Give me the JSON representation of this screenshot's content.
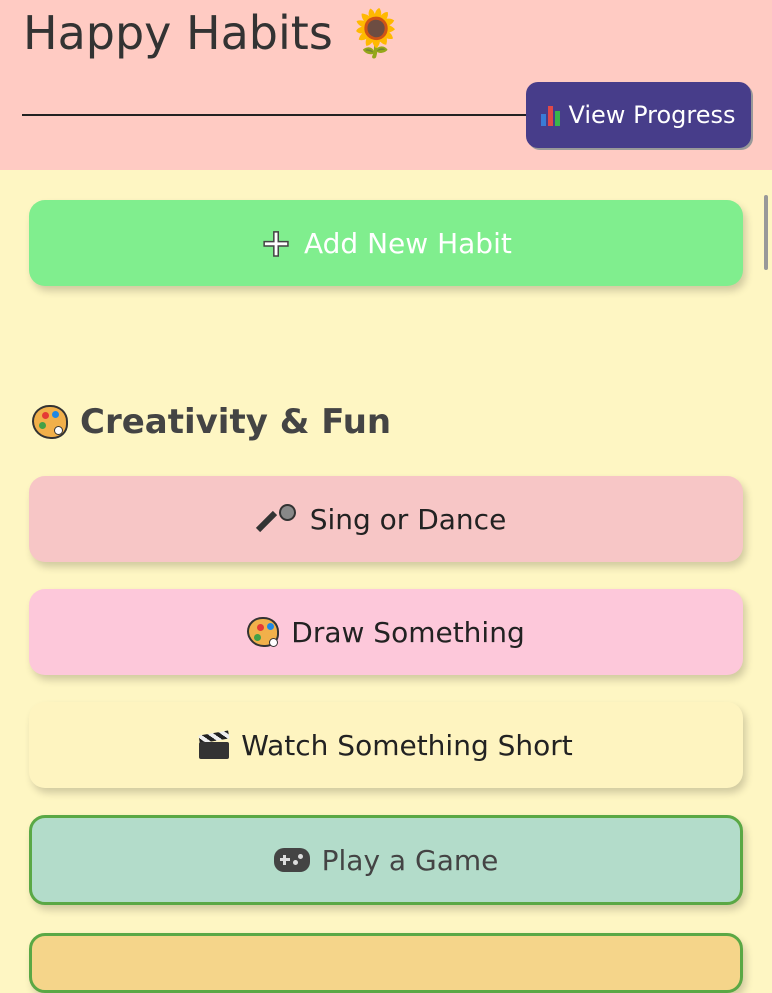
{
  "app": {
    "title": "Happy Habits",
    "title_emoji": "🌻"
  },
  "header": {
    "progress_button": {
      "icon": "bar-chart-icon",
      "label": "View Progress"
    }
  },
  "actions": {
    "add_habit": {
      "icon": "plus-icon",
      "label": "Add New Habit"
    }
  },
  "section": {
    "icon": "palette-icon",
    "title": "Creativity & Fun"
  },
  "habits": [
    {
      "icon": "microphone-icon",
      "label": "Sing or Dance",
      "color": "#f7c6c6"
    },
    {
      "icon": "palette-icon",
      "label": "Draw Something",
      "color": "#fdc8da"
    },
    {
      "icon": "clapper-board-icon",
      "label": "Watch Something Short",
      "color": "#fef4c0"
    },
    {
      "icon": "gamepad-icon",
      "label": "Play a Game",
      "color": "#b3dcca",
      "selected": true
    }
  ],
  "colors": {
    "header_bg": "#ffcbc3",
    "page_bg": "#fef6c3",
    "progress_button_bg": "#473d8a",
    "add_button_bg": "#80ee8e",
    "selected_border": "#5aa845"
  }
}
